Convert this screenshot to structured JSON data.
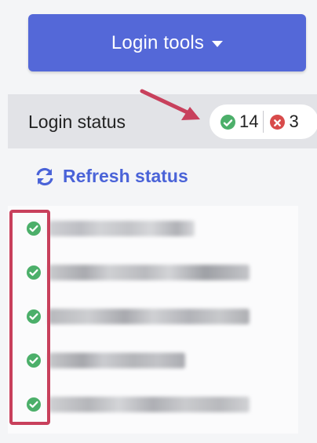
{
  "toolbar": {
    "login_tools_label": "Login tools"
  },
  "status": {
    "label": "Login status",
    "success_count": "14",
    "failure_count": "3"
  },
  "refresh": {
    "label": "Refresh status"
  },
  "accounts": {
    "count": 5,
    "state": "logged-in"
  },
  "colors": {
    "accent": "#5468d8",
    "success": "#4caf6a",
    "error": "#d84b4b",
    "highlight": "#c8405c",
    "link": "#4a63d8"
  },
  "icons": {
    "caret": "caret-down-icon",
    "ok": "check-circle-icon",
    "err": "x-circle-icon",
    "refresh": "refresh-icon",
    "arrow": "annotation-arrow-icon"
  }
}
